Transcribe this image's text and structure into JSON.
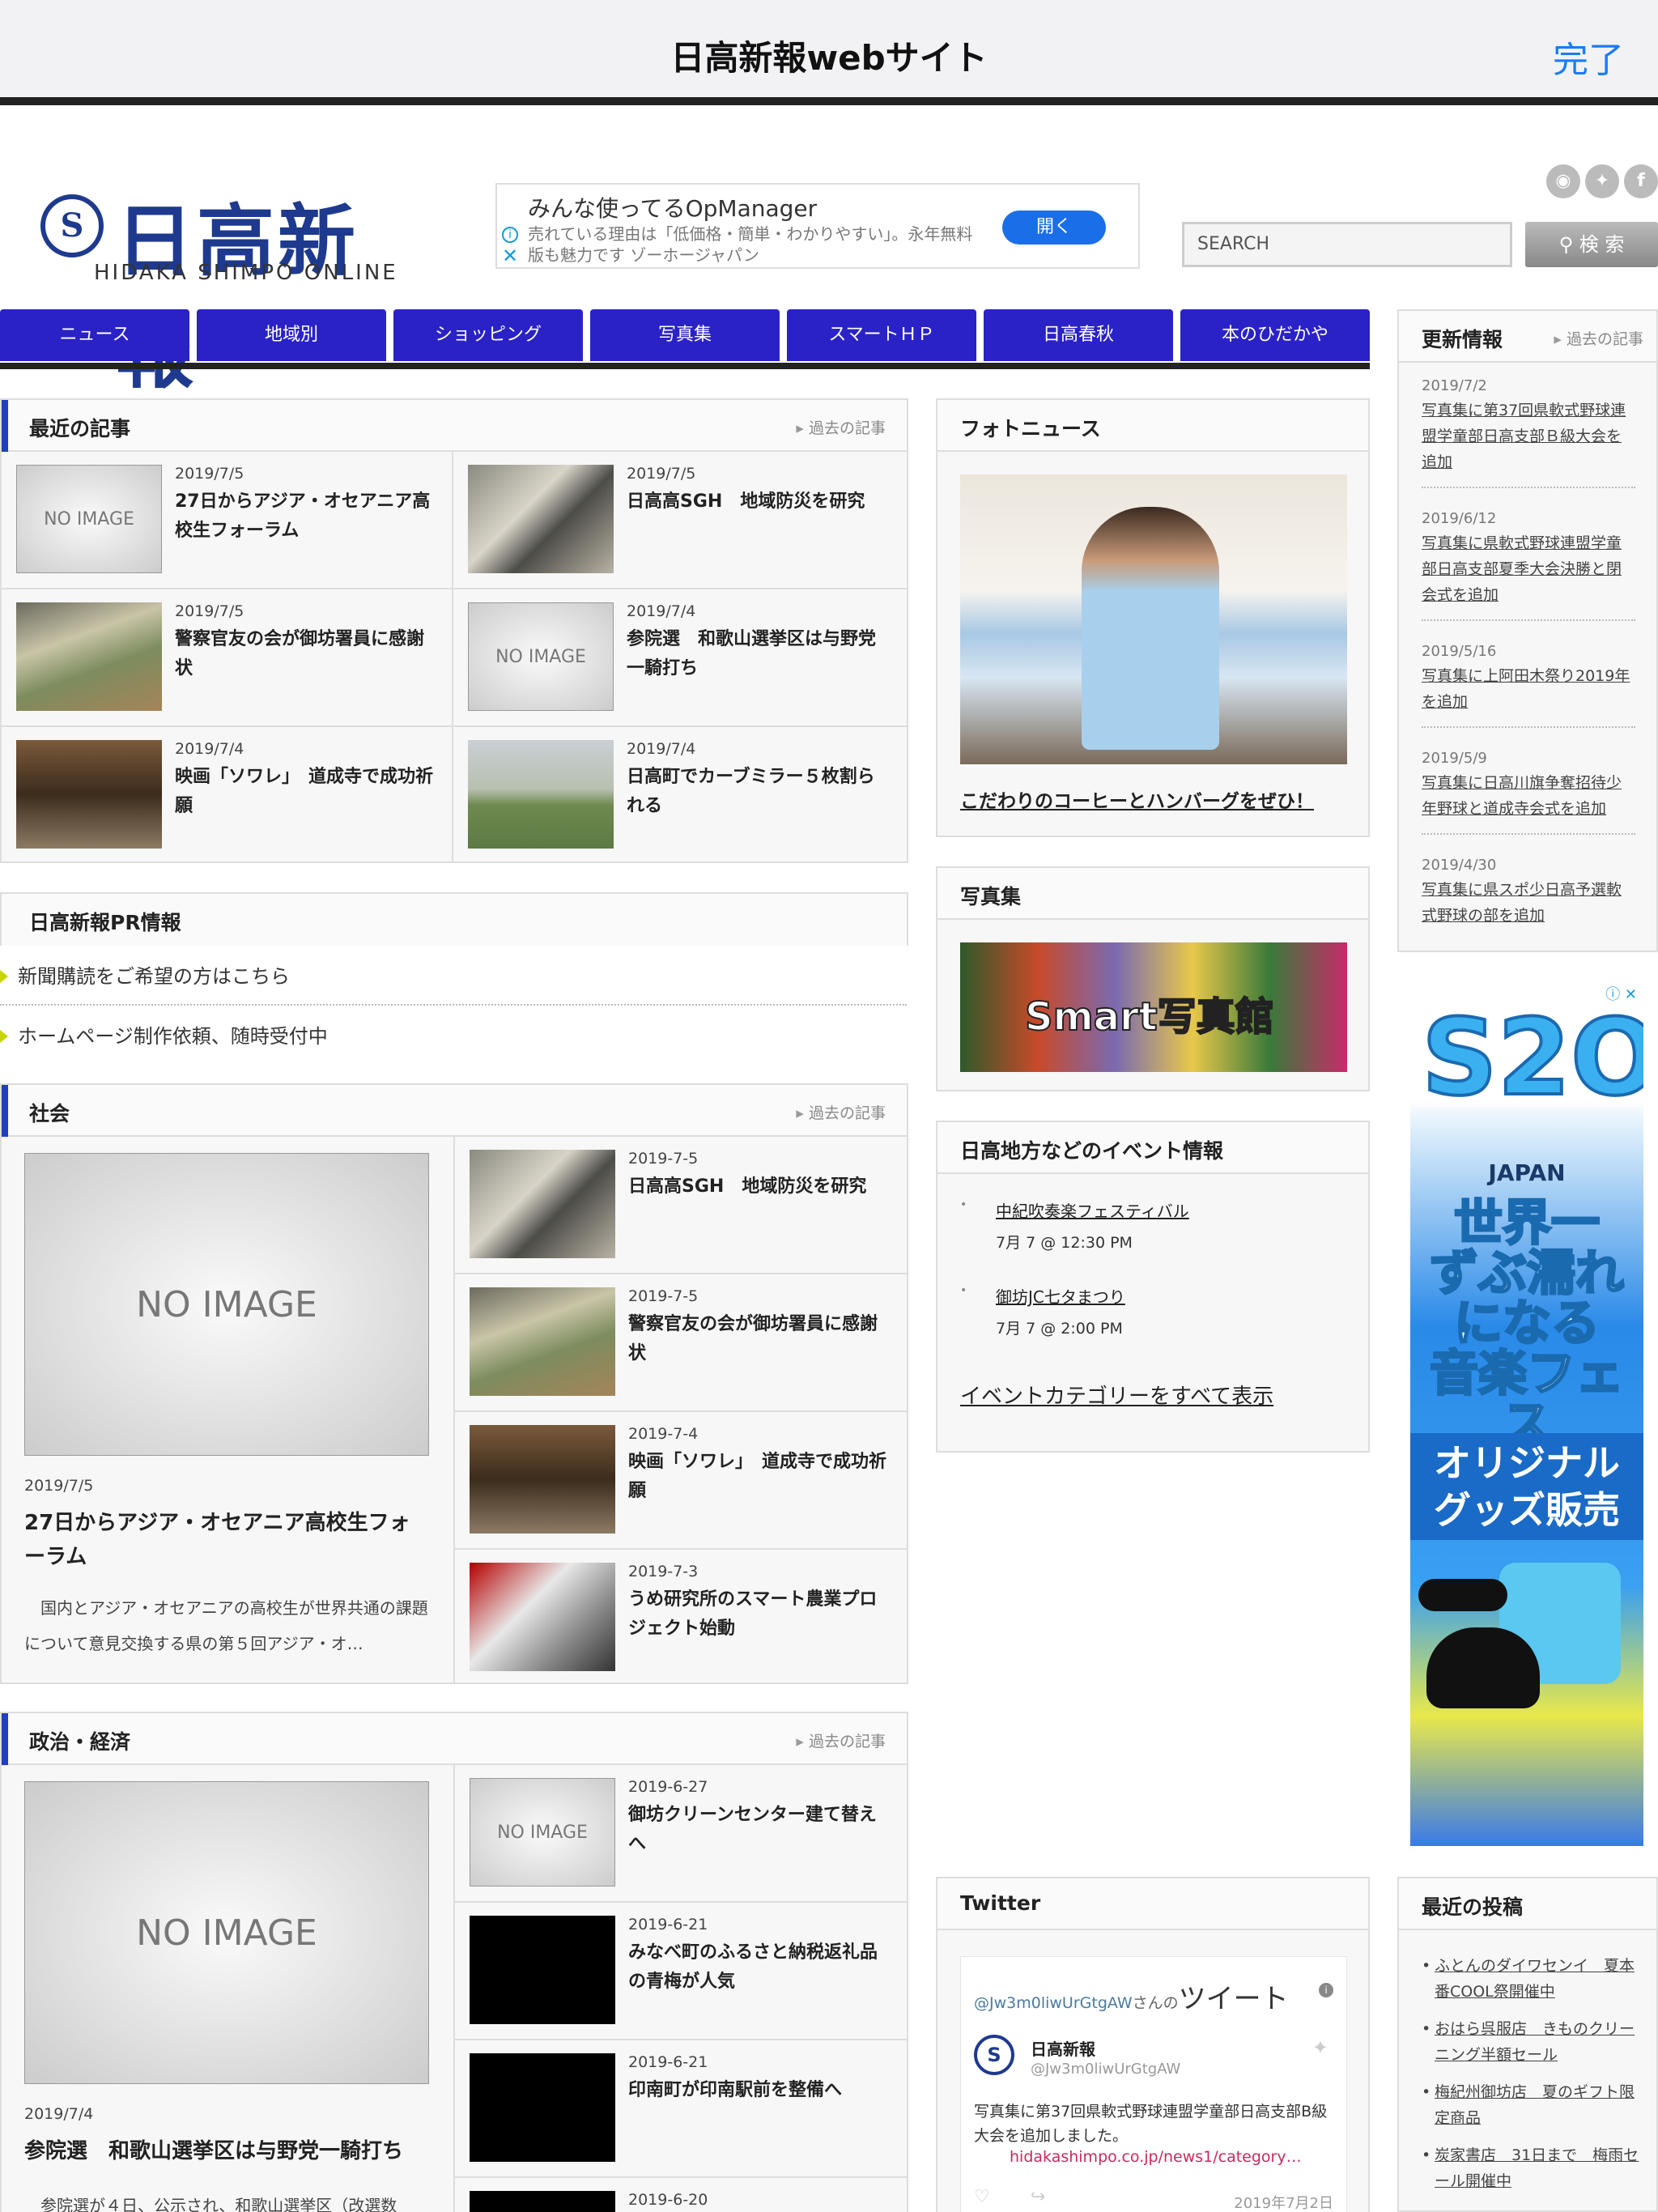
{
  "topbar": {
    "title": "日高新報webサイト",
    "done": "完了"
  },
  "logo": {
    "mark": "S",
    "name": "日高新報",
    "sub": "HIDAKA SHIMPO ONLINE"
  },
  "ad_top": {
    "headline": "みんな使ってるOpManager",
    "body": "売れている理由は「低価格・簡単・わかりやすい」。永年無料版も魅力です ゾーホージャパン",
    "button": "開く"
  },
  "search": {
    "placeholder": "SEARCH",
    "button": "検 索"
  },
  "nav": [
    "ニュース",
    "地域別",
    "ショッピング",
    "写真集",
    "スマートＨＰ",
    "日高春秋",
    "本のひだかや"
  ],
  "recent": {
    "title": "最近の記事",
    "more": "過去の記事",
    "articles": [
      {
        "date": "2019/7/5",
        "title": "27日からアジア・オセアニア高校生フォーラム",
        "thumb": "NO IMAGE"
      },
      {
        "date": "2019/7/5",
        "title": "日高高SGH　地域防災を研究"
      },
      {
        "date": "2019/7/5",
        "title": "警察官友の会が御坊署員に感謝状"
      },
      {
        "date": "2019/7/4",
        "title": "参院選　和歌山選挙区は与野党一騎打ち",
        "thumb": "NO IMAGE"
      },
      {
        "date": "2019/7/4",
        "title": "映画「ソワレ」　道成寺で成功祈願"
      },
      {
        "date": "2019/7/4",
        "title": "日高町でカーブミラー５枚割られる"
      }
    ]
  },
  "pr": {
    "title": "日高新報PR情報",
    "items": [
      "新聞購読をご希望の方はこちら",
      "ホームページ制作依頼、随時受付中"
    ]
  },
  "society": {
    "title": "社会",
    "more": "過去の記事",
    "feature": {
      "thumb": "NO IMAGE",
      "date": "2019/7/5",
      "title": "27日からアジア・オセアニア高校生フォーラム",
      "excerpt": "国内とアジア・オセアニアの高校生が世界共通の課題について意見交換する県の第５回アジア・オ…"
    },
    "list": [
      {
        "date": "2019-7-5",
        "title": "日高高SGH　地域防災を研究"
      },
      {
        "date": "2019-7-5",
        "title": "警察官友の会が御坊署員に感謝状"
      },
      {
        "date": "2019-7-4",
        "title": "映画「ソワレ」　道成寺で成功祈願"
      },
      {
        "date": "2019-7-3",
        "title": "うめ研究所のスマート農業プロジェクト始動"
      }
    ]
  },
  "politics": {
    "title": "政治・経済",
    "more": "過去の記事",
    "feature": {
      "thumb": "NO IMAGE",
      "date": "2019/7/4",
      "title": "参院選　和歌山選挙区は与野党一騎打ち",
      "excerpt": "参院選が４日、公示され、和歌山選挙区（改選数"
    },
    "list": [
      {
        "date": "2019-6-27",
        "title": "御坊クリーンセンター建て替えへ",
        "thumb": "NO IMAGE"
      },
      {
        "date": "2019-6-21",
        "title": "みなべ町のふるさと納税返礼品の青梅が人気"
      },
      {
        "date": "2019-6-21",
        "title": "印南町が印南駅前を整備へ"
      },
      {
        "date": "2019-6-20",
        "title": ""
      }
    ]
  },
  "photo_news": {
    "title": "フォトニュース",
    "caption": "こだわりのコーヒーとハンバーグをぜひ！"
  },
  "photo_album": {
    "title": "写真集",
    "banner_smart": "Smart",
    "banner_name": "写真館"
  },
  "events": {
    "title": "日高地方などのイベント情報",
    "items": [
      {
        "name": "中紀吹奏楽フェスティバル",
        "time": "7月 7 @ 12:30 PM"
      },
      {
        "name": "御坊JC七タまつり",
        "time": "7月 7 @ 2:00 PM"
      }
    ],
    "all_link": "イベントカテゴリーをすべて表示"
  },
  "twitter": {
    "title": "Twitter",
    "heading_handle": "@Jw3m0liwUrGtgAW",
    "heading_suffix": "さんの",
    "heading_big": "ツイート",
    "account_name": "日高新報",
    "account_handle": "@Jw3m0liwUrGtgAW",
    "tweet_text": "写真集に第37回県軟式野球連盟学童部日高支部B級大会を追加しました。",
    "tweet_link": "hidakashimpo.co.jp/news1/category…",
    "tweet_date": "2019年7月2日"
  },
  "updates": {
    "title": "更新情報",
    "more": "過去の記事",
    "entries": [
      {
        "date": "2019/7/2",
        "text": "写真集に第37回県軟式野球連盟学童部日高支部Ｂ級大会を追加"
      },
      {
        "date": "2019/6/12",
        "text": "写真集に県軟式野球連盟学童部日高支部夏季大会決勝と閉会式を追加"
      },
      {
        "date": "2019/5/16",
        "text": "写真集に上阿田木祭り2019年を追加"
      },
      {
        "date": "2019/5/9",
        "text": "写真集に日高川旗争奪招待少年野球と道成寺会式を追加"
      },
      {
        "date": "2019/4/30",
        "text": "写真集に県スポ少日高予選軟式野球の部を追加"
      }
    ]
  },
  "side_ad": {
    "brand": "S2O",
    "sub": "JAPAN",
    "line1": "世界一",
    "line2": "ずぶ濡れ",
    "line3": "になる",
    "line4": "音楽フェス",
    "line5": "オリジナル",
    "line6": "グッズ販売"
  },
  "recent_posts": {
    "title": "最近の投稿",
    "items": [
      "ふとんのダイワセンイ　夏本番COOL祭開催中",
      "おはら呉服店　きものクリーニング半額セール",
      "梅紀州御坊店　夏のギフト限定商品",
      "炭家書店　31日まで　梅雨セール開催中"
    ]
  },
  "colors": {
    "nav": "#2a22c6",
    "link": "#1a7cf5",
    "accent": "#1e3fbf"
  }
}
